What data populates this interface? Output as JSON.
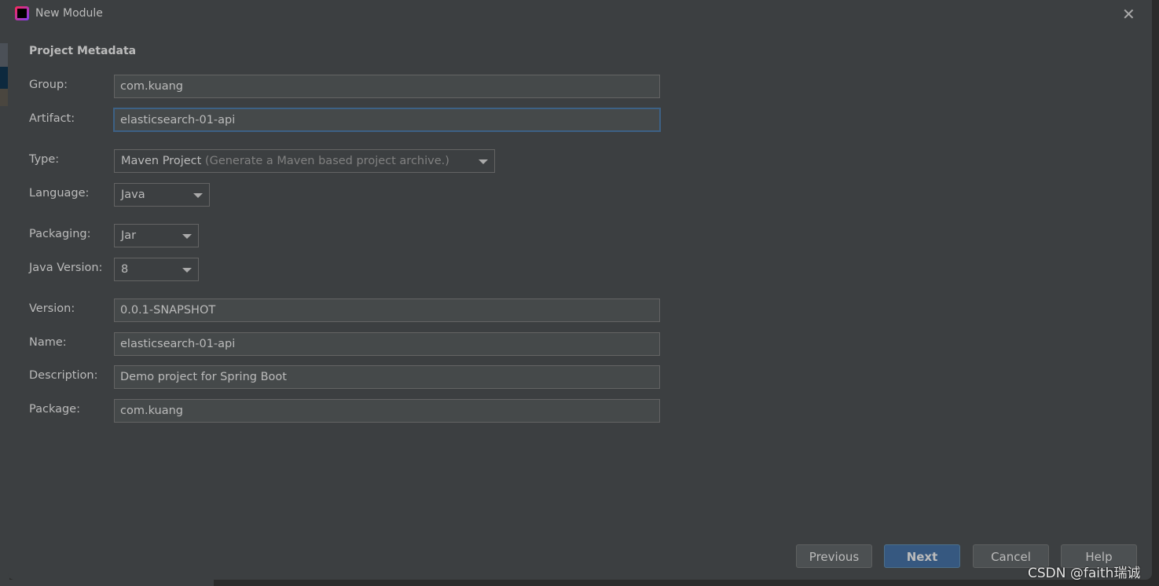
{
  "dialog": {
    "title": "New Module",
    "section": "Project Metadata"
  },
  "fields": {
    "group": {
      "label": "Group:",
      "value": "com.kuang"
    },
    "artifact": {
      "label": "Artifact:",
      "value": "elasticsearch-01-api"
    },
    "type": {
      "label": "Type:",
      "value": "Maven Project",
      "hint": "(Generate a Maven based project archive.)"
    },
    "language": {
      "label": "Language:",
      "value": "Java"
    },
    "packaging": {
      "label": "Packaging:",
      "value": "Jar"
    },
    "java_version": {
      "label": "Java Version:",
      "value": "8"
    },
    "version": {
      "label": "Version:",
      "value": "0.0.1-SNAPSHOT"
    },
    "name": {
      "label": "Name:",
      "value": "elasticsearch-01-api"
    },
    "description": {
      "label": "Description:",
      "value": "Demo project for Spring Boot"
    },
    "package": {
      "label": "Package:",
      "value": "com.kuang"
    }
  },
  "buttons": {
    "previous": "Previous",
    "next": "Next",
    "cancel": "Cancel",
    "help": "Help"
  },
  "watermark": "CSDN @faith瑞诚"
}
